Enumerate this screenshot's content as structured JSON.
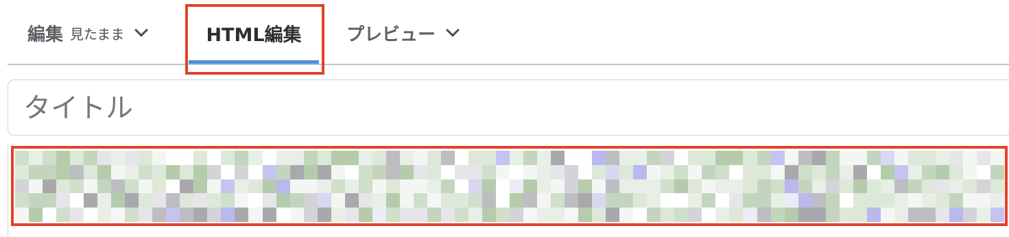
{
  "tabs": {
    "edit": {
      "label": "編集",
      "mode": "見たまま"
    },
    "html": {
      "label": "HTML編集"
    },
    "preview": {
      "label": "プレビュー"
    }
  },
  "title_field": {
    "placeholder": "タイトル",
    "value": ""
  },
  "colors": {
    "highlight": "#e0432b",
    "active_underline": "#4a90d9",
    "divider": "#b9c6d2"
  },
  "code_editor": {
    "state": "pixelated-content"
  }
}
